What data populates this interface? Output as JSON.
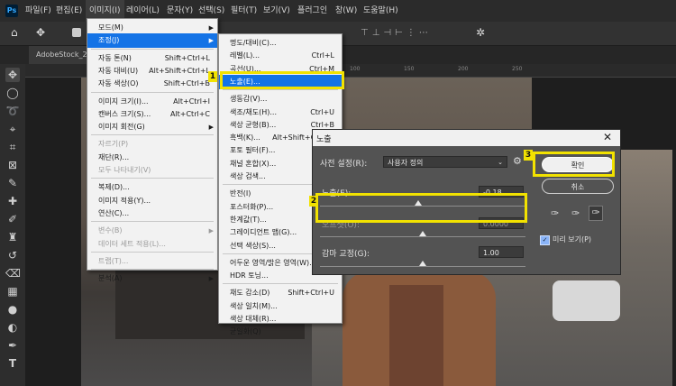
{
  "menubar": {
    "items": [
      "파일(F)",
      "편집(E)",
      "이미지(I)",
      "레이어(L)",
      "문자(Y)",
      "선택(S)",
      "필터(T)",
      "보기(V)",
      "플러그인",
      "창(W)",
      "도움말(H)"
    ]
  },
  "document": {
    "tab": "AdobeStock_2"
  },
  "ruler": {
    "ticks": [
      "0",
      "50",
      "100",
      "150",
      "200",
      "250"
    ]
  },
  "image_menu": {
    "items": [
      {
        "label": "모드(M)",
        "shortcut": "",
        "submenu": true,
        "disabled": false
      },
      {
        "label": "조정(J)",
        "shortcut": "",
        "submenu": true,
        "disabled": false,
        "highlighted": true
      },
      {
        "label": "자동 톤(N)",
        "shortcut": "Shift+Ctrl+L",
        "disabled": false
      },
      {
        "label": "자동 대비(U)",
        "shortcut": "Alt+Shift+Ctrl+L",
        "disabled": false
      },
      {
        "label": "자동 색상(O)",
        "shortcut": "Shift+Ctrl+B",
        "disabled": false
      },
      {
        "label": "이미지 크기(I)...",
        "shortcut": "Alt+Ctrl+I",
        "disabled": false
      },
      {
        "label": "캔버스 크기(S)...",
        "shortcut": "Alt+Ctrl+C",
        "disabled": false
      },
      {
        "label": "이미지 회전(G)",
        "shortcut": "",
        "submenu": true,
        "disabled": false
      },
      {
        "label": "자르기(P)",
        "shortcut": "",
        "disabled": true
      },
      {
        "label": "재단(R)...",
        "shortcut": "",
        "disabled": false
      },
      {
        "label": "모두 나타내기(V)",
        "shortcut": "",
        "disabled": true
      },
      {
        "label": "복제(D)...",
        "shortcut": "",
        "disabled": false
      },
      {
        "label": "이미지 적용(Y)...",
        "shortcut": "",
        "disabled": false
      },
      {
        "label": "연산(C)...",
        "shortcut": "",
        "disabled": false
      },
      {
        "label": "변수(B)",
        "shortcut": "",
        "submenu": true,
        "disabled": true
      },
      {
        "label": "데이터 세트 적용(L)...",
        "shortcut": "",
        "disabled": true
      },
      {
        "label": "트랩(T)...",
        "shortcut": "",
        "disabled": true
      },
      {
        "label": "분석(A)",
        "shortcut": "",
        "submenu": true,
        "disabled": false
      }
    ]
  },
  "adjust_menu": {
    "items": [
      {
        "label": "명도/대비(C)...",
        "shortcut": ""
      },
      {
        "label": "레벨(L)...",
        "shortcut": "Ctrl+L"
      },
      {
        "label": "곡선(U)...",
        "shortcut": "Ctrl+M"
      },
      {
        "label": "노출(E)...",
        "shortcut": "",
        "highlighted": true
      },
      {
        "label": "생동감(V)...",
        "shortcut": ""
      },
      {
        "label": "색조/채도(H)...",
        "shortcut": "Ctrl+U"
      },
      {
        "label": "색상 균형(B)...",
        "shortcut": "Ctrl+B"
      },
      {
        "label": "흑백(K)...",
        "shortcut": "Alt+Shift+Ctrl+B"
      },
      {
        "label": "포토 필터(F)...",
        "shortcut": ""
      },
      {
        "label": "채널 혼합(X)...",
        "shortcut": ""
      },
      {
        "label": "색상 검색...",
        "shortcut": ""
      },
      {
        "label": "반전(I)",
        "shortcut": "Ctrl+I"
      },
      {
        "label": "포스터화(P)...",
        "shortcut": ""
      },
      {
        "label": "한계값(T)...",
        "shortcut": ""
      },
      {
        "label": "그레이디언트 맵(G)...",
        "shortcut": ""
      },
      {
        "label": "선택 색상(S)...",
        "shortcut": ""
      },
      {
        "label": "어두운 영역/밝은 영역(W)...",
        "shortcut": ""
      },
      {
        "label": "HDR 토닝...",
        "shortcut": ""
      },
      {
        "label": "채도 감소(D)",
        "shortcut": "Shift+Ctrl+U"
      },
      {
        "label": "색상 일치(M)...",
        "shortcut": ""
      },
      {
        "label": "색상 대체(R)...",
        "shortcut": ""
      },
      {
        "label": "균일화(Q)",
        "shortcut": ""
      }
    ]
  },
  "callouts": [
    "1",
    "2",
    "3"
  ],
  "dialog": {
    "title": "노출",
    "preset_label": "사전 설정(R):",
    "preset_value": "사용자 정의",
    "exposure_label": "노출(E):",
    "exposure_value": "-0.18",
    "exposure_level": 0.48,
    "offset_label": "오프셋(O):",
    "offset_value": "0.0000",
    "offset_level": 0.5,
    "gamma_label": "감마 교정(G):",
    "gamma_value": "1.00",
    "gamma_level": 0.5,
    "ok_label": "확인",
    "cancel_label": "취소",
    "preview_label": "미리 보기(P)",
    "preview_checked": true
  }
}
